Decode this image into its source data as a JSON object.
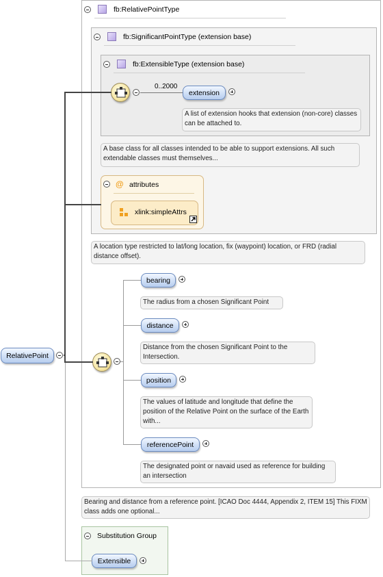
{
  "element": {
    "name": "RelativePoint"
  },
  "type": {
    "name": "fb:RelativePointType"
  },
  "significant": {
    "name": "fb:SignificantPointType (extension base)"
  },
  "extensible": {
    "name": "fb:ExtensibleType (extension base)"
  },
  "extension": {
    "occurs": "0..2000",
    "name": "extension",
    "doc": "A list of extension hooks that extension (non-core) classes can be attached to."
  },
  "extensible_doc": "A base class for all classes intended to be able to support extensions. All such extendable classes must themselves...",
  "attributes": {
    "label": "attributes",
    "group": "xlink:simpleAttrs"
  },
  "significant_doc": "A location type restricted to lat/long location, fix (waypoint) location, or FRD (radial distance offset).",
  "children": [
    {
      "name": "bearing",
      "doc": "The radius from a chosen Significant Point"
    },
    {
      "name": "distance",
      "doc": "Distance from the chosen Significant Point to the Intersection."
    },
    {
      "name": "position",
      "doc": "The values of latitude and longitude that define the position of the Relative Point on the surface of the Earth with..."
    },
    {
      "name": "referencePoint",
      "doc": "The designated point or navaid used as reference for building an intersection"
    }
  ],
  "element_doc": "Bearing and distance from a reference point. [ICAO Doc 4444, Appendix 2, ITEM 15] This FIXM class adds one optional...",
  "substitution": {
    "label": "Substitution Group",
    "member": "Extensible"
  },
  "colors": {
    "pill_border": "#6a8abf",
    "panel_border": "#b4b4b4",
    "attribute_accent": "#f0a020",
    "type_icon": "#b8a6e6"
  }
}
